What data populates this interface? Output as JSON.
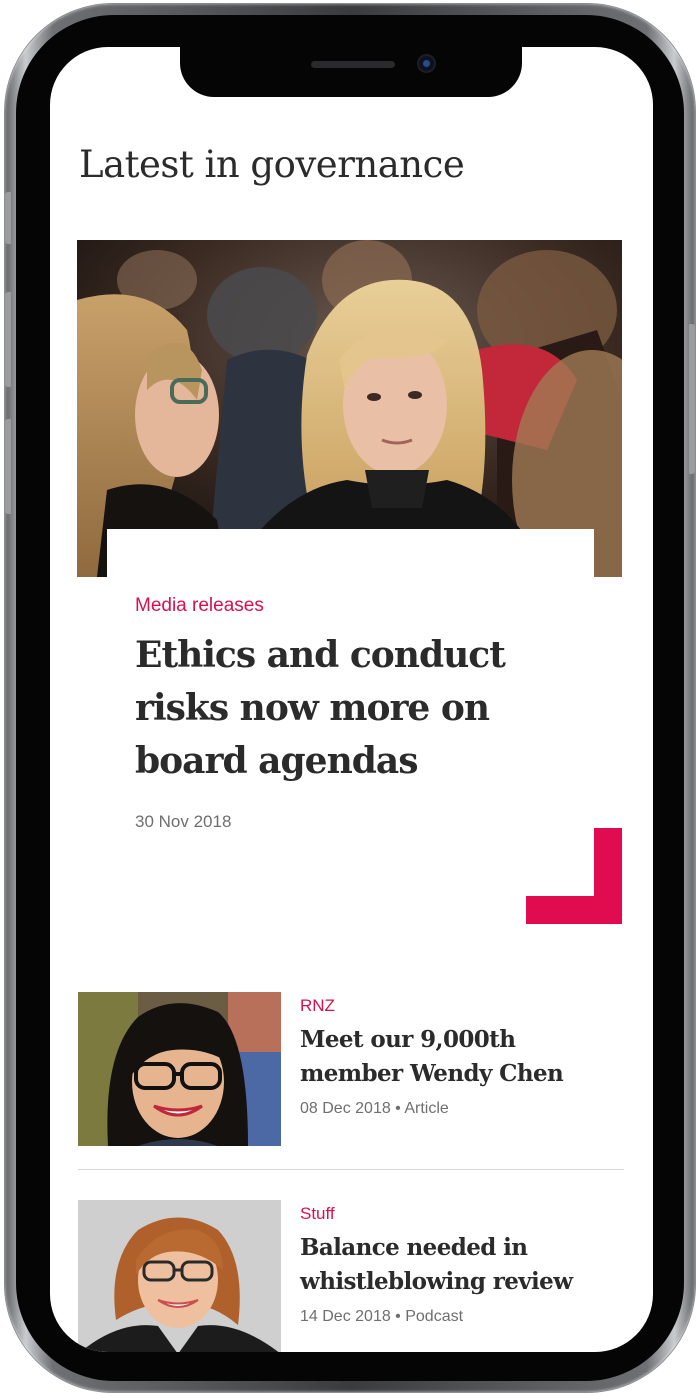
{
  "section": {
    "title": "Latest in governance"
  },
  "featured": {
    "tag": "Media releases",
    "headline": "Ethics and conduct risks now more on board agendas",
    "date": "30 Nov 2018"
  },
  "articles": [
    {
      "source": "RNZ",
      "title": "Meet our 9,000th member Wendy Chen",
      "meta": "08 Dec 2018 • Article"
    },
    {
      "source": "Stuff",
      "title": "Balance needed in whistleblowing review",
      "meta": "14 Dec 2018  •  Podcast"
    }
  ],
  "colors": {
    "accent": "#d7114f",
    "text": "#2b2b2b",
    "muted": "#6f6f6f",
    "divider": "#d9d9d9"
  },
  "icons": [
    "corner-bracket-icon"
  ]
}
